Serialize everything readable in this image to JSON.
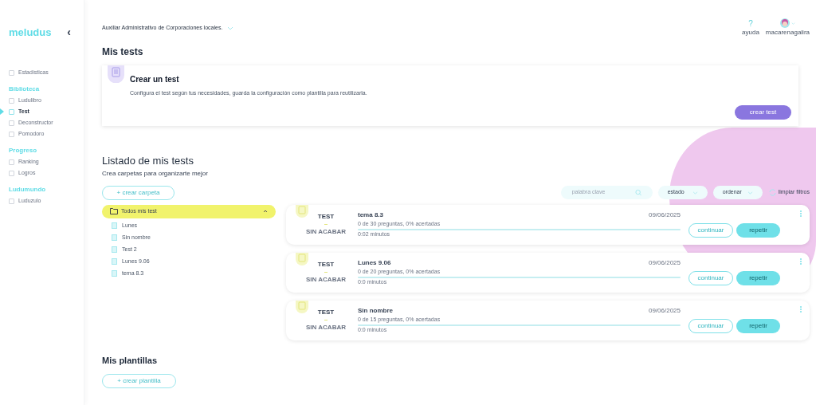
{
  "sidebar": {
    "logo": "meludus",
    "collapse": "‹",
    "items": [
      {
        "kind": "item",
        "label": "Estadísticas",
        "selected": false
      },
      {
        "kind": "heading",
        "label": "Biblioteca"
      },
      {
        "kind": "item",
        "label": "Ludulibro",
        "selected": false
      },
      {
        "kind": "item",
        "label": "Test",
        "selected": true
      },
      {
        "kind": "item",
        "label": "Deconstructor",
        "selected": false
      },
      {
        "kind": "item",
        "label": "Pomodoro",
        "selected": false
      },
      {
        "kind": "heading",
        "label": "Progreso"
      },
      {
        "kind": "item",
        "label": "Ranking",
        "selected": false
      },
      {
        "kind": "item",
        "label": "Logros",
        "selected": false
      },
      {
        "kind": "heading",
        "label": "Ludumundo"
      },
      {
        "kind": "item",
        "label": "Luduzulo",
        "selected": false
      }
    ]
  },
  "topbar": {
    "course": "Auxiliar Administrativo de Corporaciones locales.",
    "help_icon": "?",
    "help": "ayuda",
    "user": "macarenagalira"
  },
  "my_tests": {
    "title": "Mis tests",
    "create_card": {
      "title": "Crear un test",
      "description": "Configura el test según tus necesidades, guarda la configuración como plantilla para reutilizarla.",
      "button": "crear test"
    }
  },
  "list": {
    "title": "Listado de mis tests",
    "subtitle": "Crea carpetas para organizarte mejor",
    "new_folder": "+ crear carpeta",
    "search_placeholder": "palabra clave",
    "filters": [
      "estado",
      "ordenar"
    ],
    "clear": "limpiar filtros",
    "folder": {
      "label": "Todos mis test",
      "expanded": true,
      "children": [
        {
          "label": "Lunes"
        },
        {
          "label": "Sin nombre"
        },
        {
          "label": "Test 2"
        },
        {
          "label": "Lunes 9.06"
        },
        {
          "label": "tema 8.3"
        }
      ]
    },
    "tests": [
      {
        "type": "TEST",
        "status": "SIN ACABAR",
        "name": "tema 8.3",
        "date": "09/06/2025",
        "summary": "0 de 30 preguntas, 0% acertadas",
        "level": 0,
        "time": "0:02 minutos",
        "continue": "continuar",
        "repeat": "repetir"
      },
      {
        "type": "TEST",
        "status": "SIN ACABAR",
        "name": "Lunes 9.06",
        "date": "09/06/2025",
        "summary": "0 de 20 preguntas, 0% acertadas",
        "level": 0,
        "time": "0:0 minutos",
        "continue": "continuar",
        "repeat": "repetir"
      },
      {
        "type": "TEST",
        "status": "SIN ACABAR",
        "name": "Sin nombre",
        "date": "09/06/2025",
        "summary": "0 de 15 preguntas, 0% acertadas",
        "level": 0,
        "time": "0:0 minutos",
        "continue": "continuar",
        "repeat": "repetir"
      }
    ]
  },
  "templates": {
    "title": "Mis plantillas",
    "new_template": "+ crear plantilla"
  }
}
